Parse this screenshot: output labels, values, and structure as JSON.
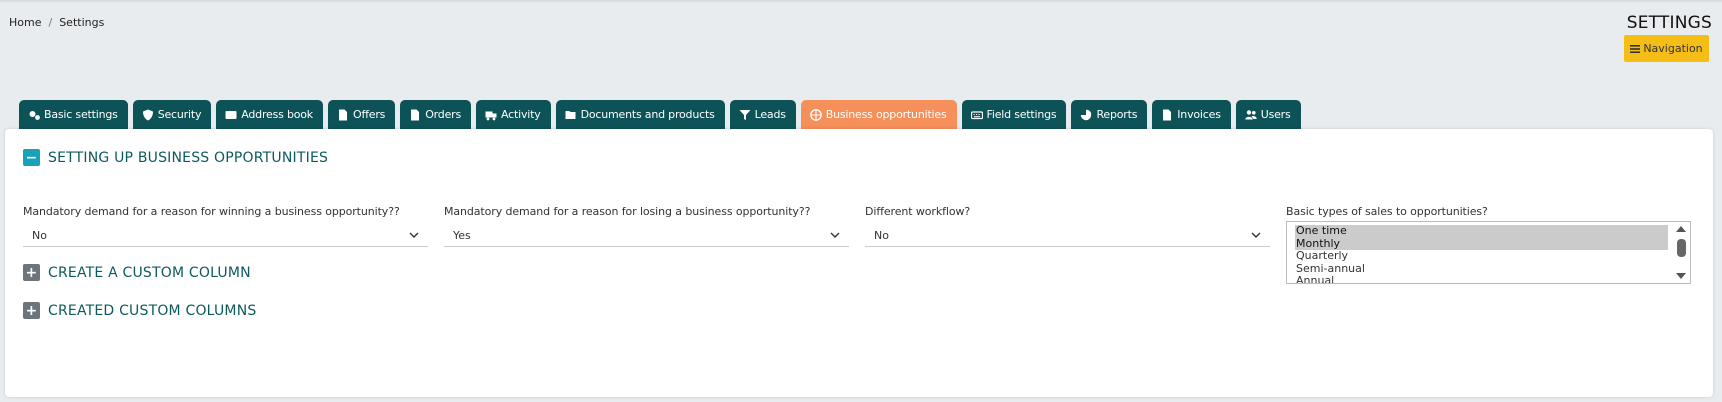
{
  "breadcrumb": {
    "home": "Home",
    "sep": "/",
    "current": "Settings"
  },
  "header": {
    "title": "SETTINGS",
    "navigation_label": "Navigation"
  },
  "tabs": [
    {
      "label": "Basic settings",
      "icon": "gears-icon"
    },
    {
      "label": "Security",
      "icon": "shield-icon"
    },
    {
      "label": "Address book",
      "icon": "address-card-icon"
    },
    {
      "label": "Offers",
      "icon": "file-icon"
    },
    {
      "label": "Orders",
      "icon": "file-icon"
    },
    {
      "label": "Activity",
      "icon": "truck-icon"
    },
    {
      "label": "Documents and products",
      "icon": "folder-open-icon"
    },
    {
      "label": "Leads",
      "icon": "funnel-dollar-icon"
    },
    {
      "label": "Business opportunities",
      "icon": "basketball-icon",
      "active": true
    },
    {
      "label": "Field settings",
      "icon": "keyboard-icon"
    },
    {
      "label": "Reports",
      "icon": "chart-pie-icon"
    },
    {
      "label": "Invoices",
      "icon": "file-invoice-icon"
    },
    {
      "label": "Users",
      "icon": "users-icon"
    }
  ],
  "sections": {
    "setup": "SETTING UP BUSINESS OPPORTUNITIES",
    "create_custom": "CREATE A CUSTOM COLUMN",
    "created_custom": "CREATED CUSTOM COLUMNS"
  },
  "fields": {
    "win_reason": {
      "label": "Mandatory demand for a reason for winning a business opportunity??",
      "value": "No"
    },
    "lose_reason": {
      "label": "Mandatory demand for a reason for losing a business opportunity??",
      "value": "Yes"
    },
    "workflow": {
      "label": "Different workflow?",
      "value": "No"
    },
    "sales_types": {
      "label": "Basic types of sales to opportunities?",
      "options": [
        {
          "label": "One time",
          "selected": true
        },
        {
          "label": "Monthly",
          "selected": true
        },
        {
          "label": "Quarterly",
          "selected": false
        },
        {
          "label": "Semi-annual",
          "selected": false
        },
        {
          "label": "Annual",
          "selected": false
        }
      ]
    }
  },
  "colors": {
    "tab": "#0c5257",
    "tab_active": "#f5905b",
    "nav_button": "#f5be16",
    "section_text": "#0d5a5e"
  }
}
